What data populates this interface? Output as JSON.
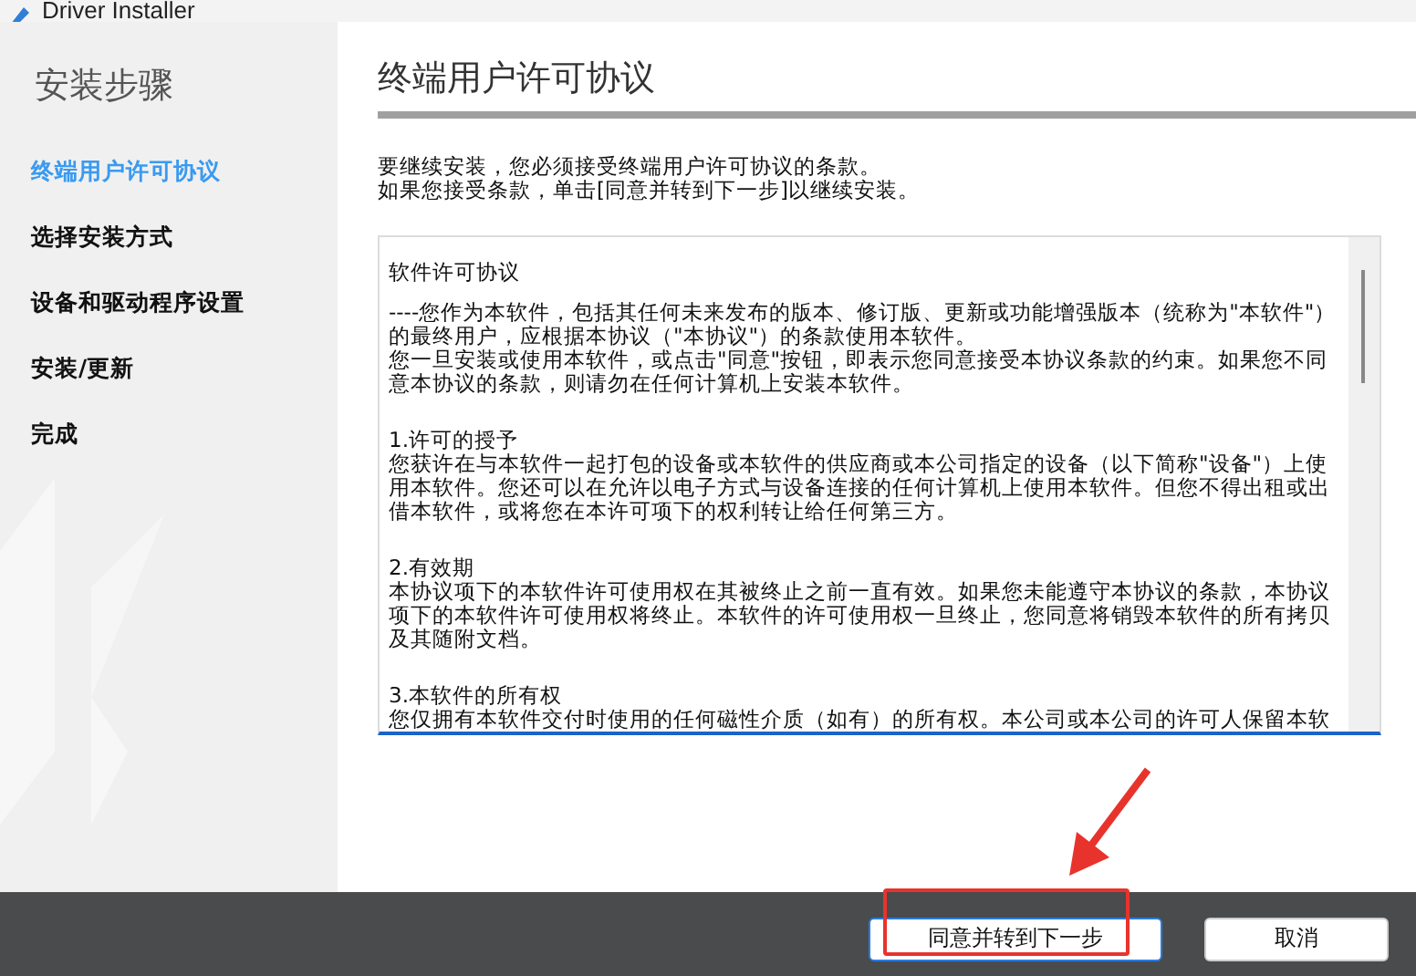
{
  "window": {
    "title": "Driver Installer"
  },
  "sidebar": {
    "title": "安装步骤",
    "steps": [
      {
        "label": "终端用户许可协议",
        "selected": true
      },
      {
        "label": "选择安装方式",
        "selected": false
      },
      {
        "label": "设备和驱动程序设置",
        "selected": false
      },
      {
        "label": "安装/更新",
        "selected": false
      },
      {
        "label": "完成",
        "selected": false
      }
    ]
  },
  "page": {
    "heading": "终端用户许可协议",
    "intro": [
      "要继续安装，您必须接受终端用户许可协议的条款。",
      "如果您接受条款，单击[同意并转到下一步]以继续安装。"
    ]
  },
  "license": {
    "title": "软件许可协议",
    "sections": [
      {
        "lines": [
          "----您作为本软件，包括其任何未来发布的版本、修订版、更新或功能增强版本（统称为\"本软件\"）",
          "的最终用户，应根据本协议（\"本协议\"）的条款使用本软件。",
          "您一旦安装或使用本软件，或点击\"同意\"按钮，即表示您同意接受本协议条款的约束。如果您不同",
          "意本协议的条款，则请勿在任何计算机上安装本软件。"
        ]
      },
      {
        "heading": "1.许可的授予",
        "lines": [
          "您获许在与本软件一起打包的设备或本软件的供应商或本公司指定的设备（以下简称\"设备\"）上使",
          "用本软件。您还可以在允许以电子方式与设备连接的任何计算机上使用本软件。但您不得出租或出",
          "借本软件，或将您在本许可项下的权利转让给任何第三方。"
        ]
      },
      {
        "heading": "2.有效期",
        "lines": [
          "本协议项下的本软件许可使用权在其被终止之前一直有效。如果您未能遵守本协议的条款，本协议",
          "项下的本软件许可使用权将终止。本软件的许可使用权一旦终止，您同意将销毁本软件的所有拷贝",
          "及其随附文档。"
        ]
      },
      {
        "heading": "3.本软件的所有权",
        "lines": [
          "您仅拥有本软件交付时使用的任何磁性介质（如有）的所有权。本公司或本公司的许可人保留本软"
        ]
      }
    ]
  },
  "buttons": [
    {
      "label": "同意并转到下一步",
      "kind": "primary"
    },
    {
      "label": "取消",
      "kind": "secondary"
    }
  ]
}
